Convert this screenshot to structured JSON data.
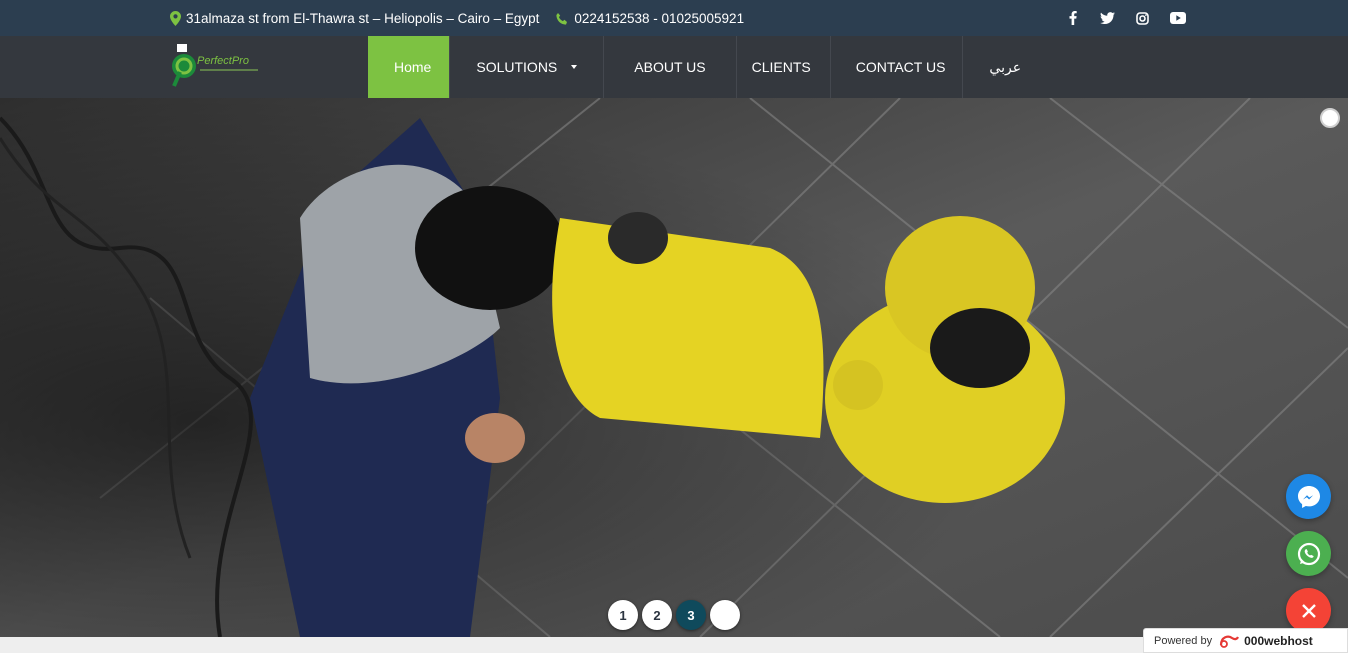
{
  "topbar": {
    "address": "31almaza st from El-Thawra st – Heliopolis – Cairo – Egypt",
    "phone": "0224152538 - 01025005921",
    "social": [
      "facebook-icon",
      "twitter-icon",
      "instagram-icon",
      "youtube-icon"
    ]
  },
  "logo": {
    "text": "PerfectPro"
  },
  "nav": {
    "items": [
      {
        "label": "Home",
        "active": true
      },
      {
        "label": "SOLUTIONS",
        "dropdown": true
      },
      {
        "label": "ABOUT US"
      },
      {
        "label": "CLIENTS"
      },
      {
        "label": "CONTACT US"
      },
      {
        "label": "عربي"
      }
    ]
  },
  "slider": {
    "pages": [
      "1",
      "2",
      "3",
      ""
    ],
    "active_index": 2
  },
  "floating": {
    "messenger_color": "#1e88e5",
    "whatsapp_color": "#4caf50",
    "close_color": "#f44336"
  },
  "footer_badge": {
    "prefix": "Powered by",
    "brand": "000webhost"
  },
  "colors": {
    "accent": "#7dc242",
    "topbar": "#2c3e50",
    "nav": "#34383e"
  }
}
